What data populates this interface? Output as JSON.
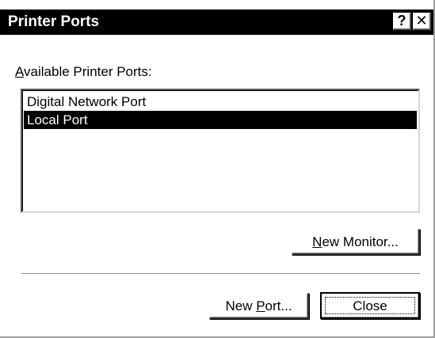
{
  "window": {
    "title": "Printer Ports",
    "help_glyph": "?",
    "close_glyph": "✕"
  },
  "ports_label": {
    "accel": "A",
    "rest": "vailable Printer Ports:"
  },
  "ports_list": {
    "items": [
      {
        "label": "Digital Network Port",
        "selected": false
      },
      {
        "label": "Local Port",
        "selected": true
      }
    ]
  },
  "buttons": {
    "new_monitor": {
      "accel": "N",
      "rest": "ew Monitor..."
    },
    "new_port": {
      "pre": "New ",
      "accel": "P",
      "rest": "ort..."
    },
    "close": {
      "label": "Close"
    }
  },
  "colors": {
    "title_bg": "#000000",
    "title_fg": "#ffffff",
    "selection_bg": "#000000",
    "selection_fg": "#ffffff"
  },
  "icons": {
    "help": "help-icon",
    "close": "close-icon"
  }
}
